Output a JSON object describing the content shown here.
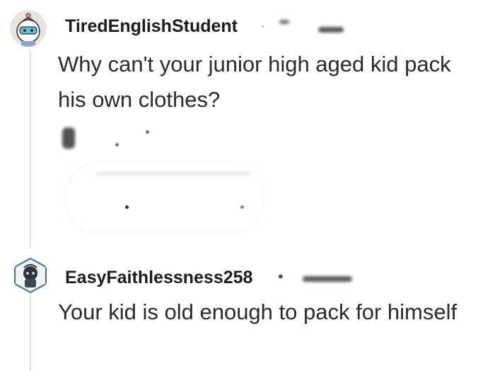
{
  "comments": [
    {
      "username": "TiredEnglishStudent",
      "avatar_icon": "snoo-avatar-icon",
      "body": "Why can't your junior high aged kid pack his own clothes?"
    },
    {
      "username": "EasyFaithlessness258",
      "avatar_icon": "snoo-avatar-dark-icon",
      "separator": "•",
      "body": "Your kid is old enough to pack for himself"
    }
  ],
  "colors": {
    "username": "#1c1c1c",
    "body_text": "#2a2a2a",
    "thread_line": "#e6e6e6",
    "background": "#ffffff"
  }
}
